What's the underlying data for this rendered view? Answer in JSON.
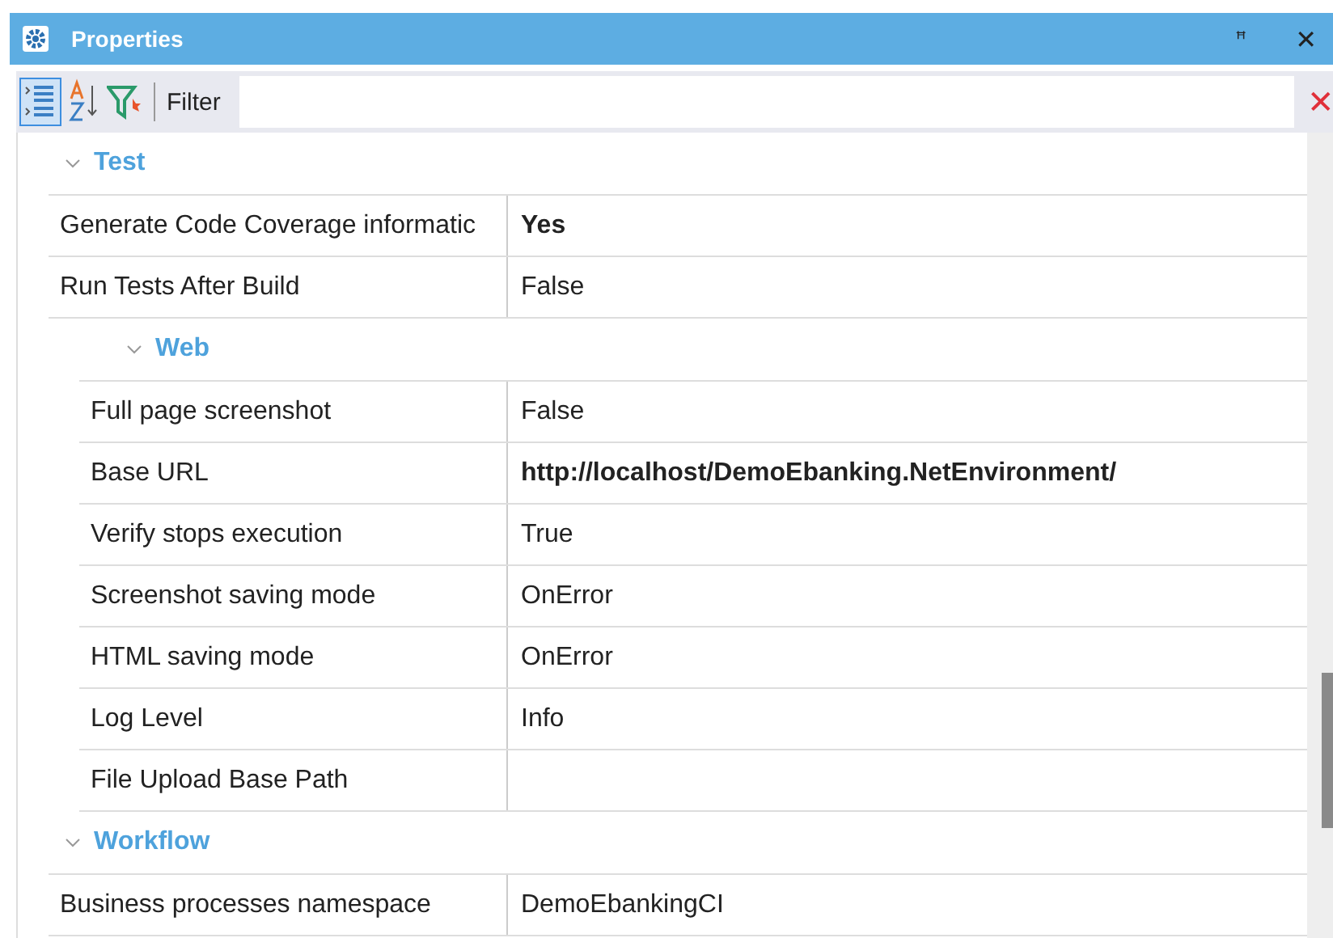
{
  "window": {
    "title": "Properties",
    "buttons": [
      "ꟸ",
      "✕"
    ]
  },
  "toolbar": {
    "views": [
      {
        "kind": "categorized",
        "selected": true
      },
      {
        "kind": "alphabetical",
        "selected": false
      }
    ],
    "filter_label": "Filter",
    "clear": "✕"
  },
  "tree": [
    {
      "kind": "category",
      "label": "Test",
      "expanded": true,
      "children": [
        {
          "kind": "property",
          "name": "Generate Code Coverage informatic",
          "value": "Yes",
          "modified": true
        },
        {
          "kind": "property",
          "name": "Run Tests After Build",
          "value": "False",
          "modified": false
        },
        {
          "kind": "category",
          "label": "Web",
          "expanded": true,
          "children": [
            {
              "kind": "property",
              "name": "Full page screenshot",
              "value": "False",
              "modified": false
            },
            {
              "kind": "property",
              "name": "Base URL",
              "value": "http://localhost/DemoEbanking.NetEnvironment/",
              "modified": true
            },
            {
              "kind": "property",
              "name": "Verify stops execution",
              "value": "True",
              "modified": false
            },
            {
              "kind": "property",
              "name": "Screenshot saving mode",
              "value": "OnError",
              "modified": false
            },
            {
              "kind": "property",
              "name": "HTML saving mode",
              "value": "OnError",
              "modified": false
            },
            {
              "kind": "property",
              "name": "Log Level",
              "value": "Info",
              "modified": false
            },
            {
              "kind": "property",
              "name": "File Upload Base Path",
              "modified": false
            }
          ]
        }
      ]
    },
    {
      "kind": "category",
      "label": "Workflow",
      "expanded": true,
      "children": [
        {
          "kind": "property",
          "name": "Business processes namespace",
          "value": "DemoEbankingCI",
          "modified": false
        }
      ]
    }
  ]
}
